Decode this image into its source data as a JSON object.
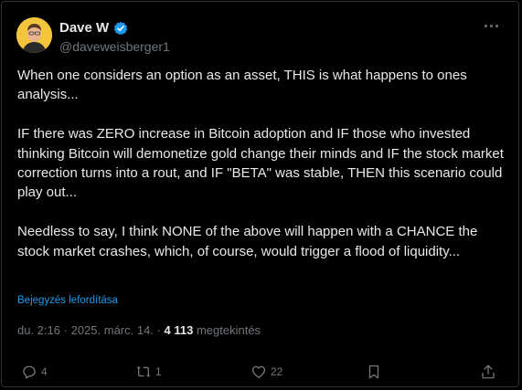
{
  "author": {
    "name": "Dave W",
    "handle": "@daveweisberger1"
  },
  "paragraphs": [
    "When one considers an option as an asset, THIS is what happens to ones analysis...",
    "IF there was ZERO increase in Bitcoin adoption and IF those who invested thinking Bitcoin will demonetize gold change their minds and IF the stock market correction turns into a rout, and IF \"BETA\" was stable, THEN this scenario could play out...",
    "Needless to say, I think NONE of the above will happen with a CHANCE the stock market crashes, which, of course, would trigger a flood of liquidity..."
  ],
  "translate_label": "Bejegyzés lefordítása",
  "meta": {
    "time": "du. 2:16",
    "separator": "·",
    "date": "2025. márc. 14.",
    "views": "4 113",
    "views_label": "megtekintés"
  },
  "actions": {
    "replies": "4",
    "reposts": "1",
    "likes": "22"
  },
  "colors": {
    "accent": "#1d9bf0",
    "muted": "#71767b",
    "text": "#e7e9ea",
    "background": "#000000"
  },
  "icons": [
    "verified-badge-icon",
    "more-icon",
    "reply-icon",
    "repost-icon",
    "like-icon",
    "bookmark-icon",
    "share-icon"
  ]
}
